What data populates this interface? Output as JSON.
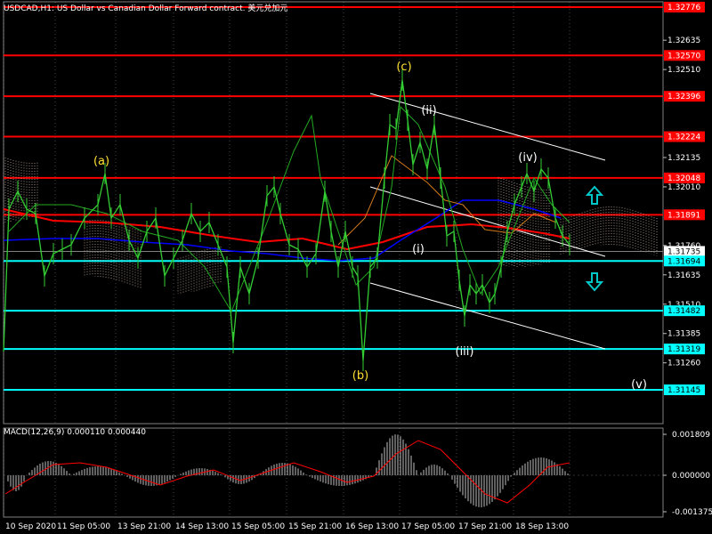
{
  "title": "USDCAD,H1: US Dollar vs Canadian Dollar Forward contract. 美元兑加元",
  "macd_label": "MACD(12,26,9) 0.000110 0.000440",
  "colors": {
    "background": "#000000",
    "grid": "#c0c0c0",
    "price_line": "#33cc33",
    "resistance": "#ff0000",
    "support": "#00ffff",
    "channel": "#ffffff",
    "wave_label": "#ffe033",
    "wave_label_alt": "#ffffff",
    "ma_red": "#ff0000",
    "ma_blue": "#0000ff",
    "ma_brown": "#d07a1a",
    "macd_hist": "#c0c0c0",
    "macd_signal": "#ff0000",
    "arrow": "#00c8c8"
  },
  "chart_data": {
    "type": "line",
    "symbol": "USDCAD",
    "timeframe": "H1",
    "y_axis_ticks": [
      "1.32635",
      "1.32510",
      "1.32135",
      "1.32010",
      "1.31760",
      "1.31635",
      "1.31510",
      "1.31385",
      "1.31260"
    ],
    "resistance_levels": [
      "1.32776",
      "1.32570",
      "1.32396",
      "1.32224",
      "1.32048",
      "1.31891"
    ],
    "current_price_labels": [
      "1.31735",
      "1.31694"
    ],
    "support_levels": [
      "1.31482",
      "1.31319",
      "1.31145"
    ],
    "x_axis_labels": [
      "10 Sep 2020",
      "11 Sep 05:00",
      "13 Sep 21:00",
      "14 Sep 13:00",
      "15 Sep 05:00",
      "15 Sep 21:00",
      "16 Sep 13:00",
      "17 Sep 05:00",
      "17 Sep 21:00",
      "18 Sep 13:00"
    ],
    "wave_labels": [
      {
        "text": "(a)",
        "style": "yellow"
      },
      {
        "text": "(b)",
        "style": "yellow"
      },
      {
        "text": "(c)",
        "style": "yellow"
      },
      {
        "text": "(i)",
        "style": "white"
      },
      {
        "text": "(ii)",
        "style": "white"
      },
      {
        "text": "(iii)",
        "style": "white"
      },
      {
        "text": "(iv)",
        "style": "white"
      },
      {
        "text": "(v)",
        "style": "white"
      }
    ],
    "macd": {
      "params": "12,26,9",
      "main": 0.00011,
      "signal": 0.00044,
      "ticks": [
        "0.001809",
        "0.000000",
        "-0.001375"
      ]
    }
  }
}
